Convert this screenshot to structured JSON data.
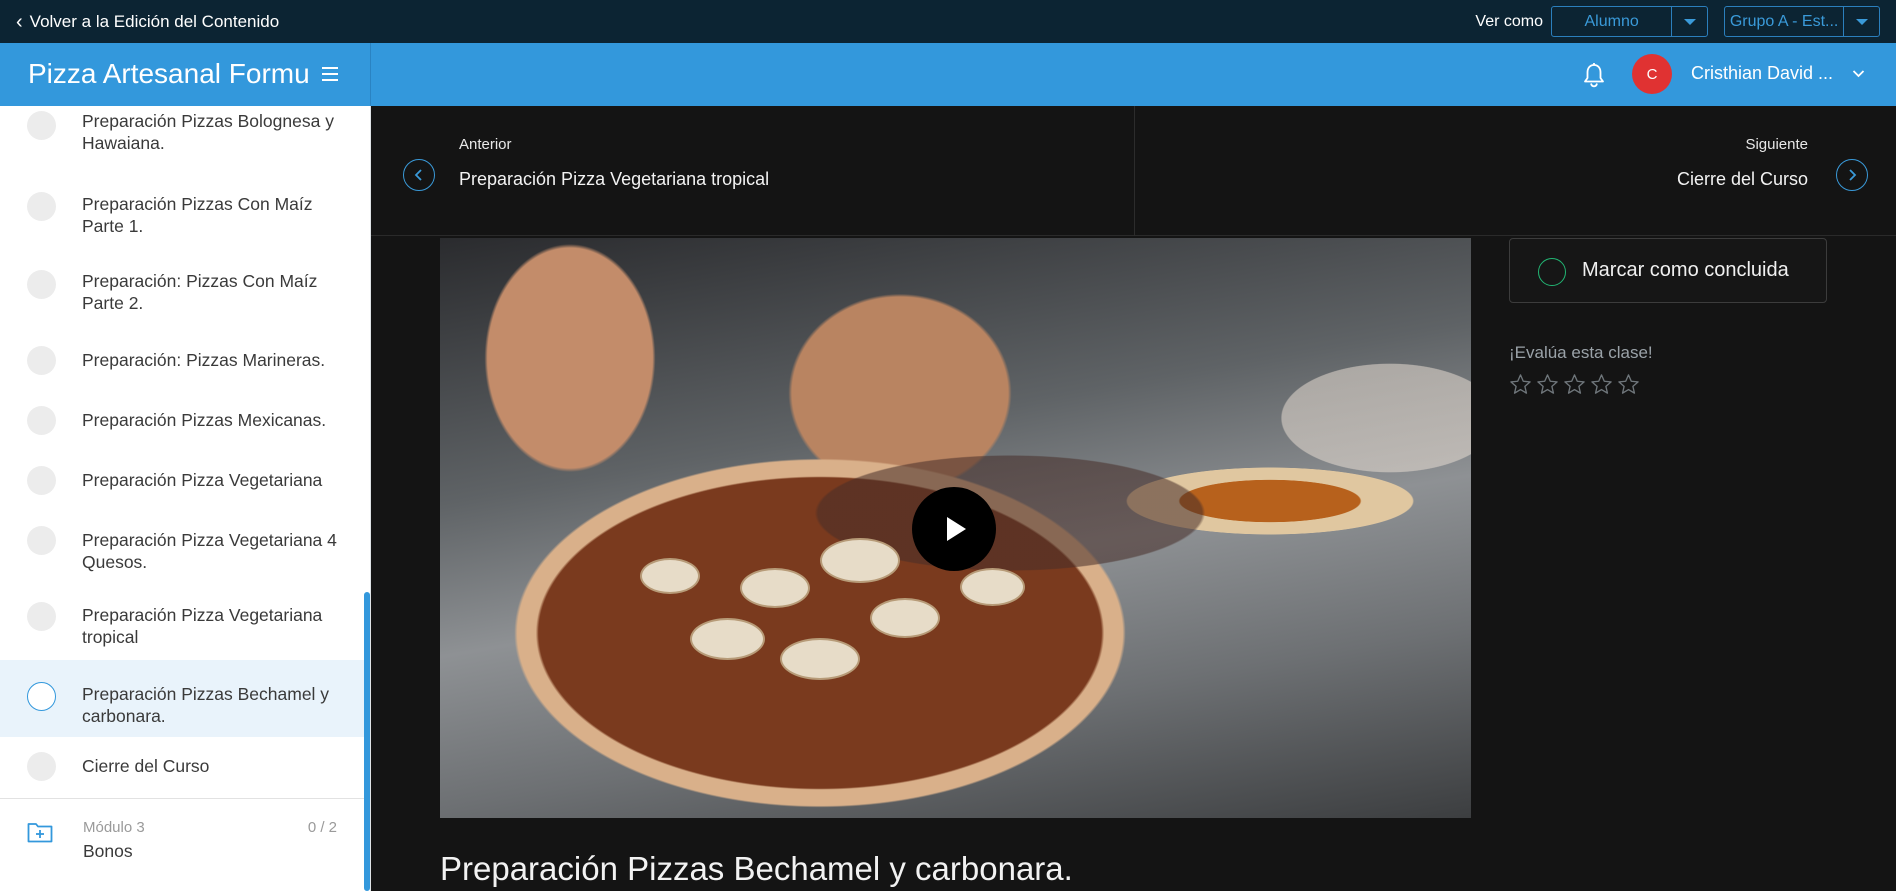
{
  "topbar": {
    "back_label": "Volver a la Edición del Contenido",
    "view_as_label": "Ver como",
    "role_select": "Alumno",
    "group_select": "Grupo A - Est..."
  },
  "header": {
    "course_title": "Pizza Artesanal Formulado",
    "user_initial": "C",
    "user_name": "Cristhian David ..."
  },
  "sidebar": {
    "lessons": [
      {
        "label": "Preparación Pizzas Bolognesa y Hawaiana."
      },
      {
        "label": "Preparación Pizzas Con Maíz Parte 1."
      },
      {
        "label": "Preparación: Pizzas Con Maíz Parte 2."
      },
      {
        "label": "Preparación: Pizzas Marineras."
      },
      {
        "label": "Preparación Pizzas Mexicanas."
      },
      {
        "label": "Preparación Pizza Vegetariana"
      },
      {
        "label": "Preparación Pizza Vegetariana 4 Quesos."
      },
      {
        "label": "Preparación Pizza Vegetariana tropical"
      },
      {
        "label": "Preparación Pizzas Bechamel y carbonara."
      },
      {
        "label": "Cierre del Curso"
      }
    ],
    "module": {
      "label": "Módulo 3",
      "count": "0 / 2",
      "name": "Bonos"
    }
  },
  "nav": {
    "prev_label": "Anterior",
    "prev_title": "Preparación Pizza Vegetariana tropical",
    "next_label": "Siguiente",
    "next_title": "Cierre del Curso"
  },
  "panel": {
    "complete_label": "Marcar como concluida",
    "rate_label": "¡Evalúa esta clase!",
    "rating": 0,
    "rating_max": 5
  },
  "content": {
    "lesson_title": "Preparación Pizzas Bechamel y carbonara."
  },
  "colors": {
    "header_blue": "#3398dc",
    "topbar_navy": "#0c2433",
    "avatar_red": "#e03232",
    "complete_green": "#22b573"
  }
}
